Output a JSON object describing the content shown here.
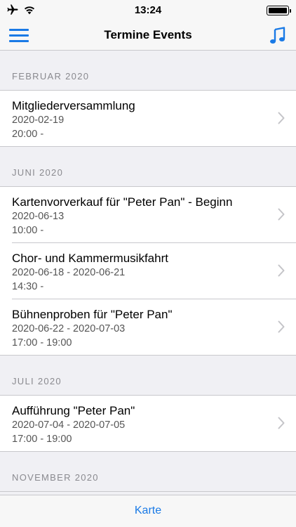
{
  "status": {
    "time": "13:24"
  },
  "nav": {
    "title": "Termine Events"
  },
  "sections": [
    {
      "header": "FEBRUAR 2020",
      "events": [
        {
          "title": "Mitgliederversammlung",
          "date": "2020-02-19",
          "time": "20:00 -"
        }
      ]
    },
    {
      "header": "JUNI 2020",
      "events": [
        {
          "title": "Kartenvorverkauf für \"Peter Pan\" - Beginn",
          "date": "2020-06-13",
          "time": "10:00 -"
        },
        {
          "title": "Chor- und Kammermusikfahrt",
          "date": "2020-06-18 - 2020-06-21",
          "time": "14:30 -"
        },
        {
          "title": "Bühnenproben für \"Peter Pan\"",
          "date": "2020-06-22 - 2020-07-03",
          "time": "17:00 - 19:00"
        }
      ]
    },
    {
      "header": "JULI 2020",
      "events": [
        {
          "title": "Aufführung \"Peter Pan\"",
          "date": "2020-07-04 - 2020-07-05",
          "time": "17:00 - 19:00"
        }
      ]
    },
    {
      "header": "NOVEMBER 2020",
      "events": []
    }
  ],
  "tabbar": {
    "label": "Karte"
  },
  "colors": {
    "accent": "#1a7ae6",
    "background": "#f0f0f4",
    "separator": "#c8c8cc"
  },
  "icons": {
    "menu": "hamburger-icon",
    "music": "music-note-icon",
    "chevron": "chevron-right-icon"
  }
}
